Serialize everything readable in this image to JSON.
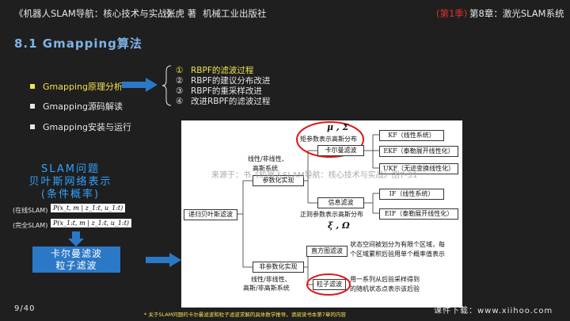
{
  "header": {
    "book_title": "《机器人SLAM导航：核心技术与实战》",
    "author": "张虎 著",
    "publisher": "机械工业出版社",
    "season": "(第1季)",
    "chapter": "第8章：激光SLAM系统"
  },
  "slide": {
    "title": "8.1 Gmapping算法",
    "bullets": [
      {
        "label": "Gmapping原理分析",
        "active": true
      },
      {
        "label": "Gmapping源码解读",
        "active": false
      },
      {
        "label": "Gmapping安装与运行",
        "active": false
      }
    ],
    "subitems": [
      {
        "num": "①",
        "label": "RBPF的滤波过程"
      },
      {
        "num": "②",
        "label": "RBPF的建议分布改进"
      },
      {
        "num": "③",
        "label": "RBPF的重采样改进"
      },
      {
        "num": "④",
        "label": "改进RBPF的滤波过程"
      }
    ],
    "bayes": {
      "line1": "SLAM问题",
      "line2": "贝叶斯网络表示",
      "line3": "(条件概率)"
    },
    "online_label": "(在线SLAM)",
    "online_eq": "P(x_t, m | z_1:t, u_1:t)",
    "full_label": "(完全SLAM)",
    "full_eq": "P(x_1:t, m | z_1:t, u_1:t)",
    "kf_line1": "卡尔曼滤波",
    "kf_line2": "粒子滤波"
  },
  "diagram": {
    "recursive_bayes": "递归贝叶斯滤波",
    "parametric": "参数化实现",
    "parametric_desc_1": "线性/非线性、",
    "parametric_desc_2": "高斯系统",
    "nonparametric": "非参数化实现",
    "nonparametric_desc_1": "线性/非线性、",
    "nonparametric_desc_2": "高斯/非高斯系统",
    "moment_symbol": "μ , Σ",
    "moment_desc": "矩参数表示高斯分布",
    "kalman": "卡尔曼滤波",
    "info_filter": "信息滤波",
    "canonical_desc": "正则参数表示高斯分布",
    "canonical_symbol": "ξ , Ω",
    "histogram": "直方图滤波",
    "histogram_desc_1": "状态空间被划分为有限个区域，每",
    "histogram_desc_2": "个区域累积后验用单个概率值表示",
    "particle": "粒子滤波",
    "particle_desc_1": "用一系列从后验采样得到",
    "particle_desc_2": "的随机状态点表示该后验",
    "kf": "KF（线性系统）",
    "ekf": "EKF（泰勒展开线性化）",
    "ukf": "UKF（无迹变换线性化）",
    "if": "IF（线性系统）",
    "eif": "EIF（泰勒展开线性化）",
    "watermark": "来源于：书《机器人SLAM导航：核心技术与实战》图7-31"
  },
  "footer": {
    "page": "9/40",
    "note": "* 关于SLAM问题的卡尔曼滤波和粒子滤波求解的具体数学推导，请阅读书本第7章的内容",
    "download": "课件下载：www.xiihoo.com"
  },
  "colors": {
    "accent_yellow": "#f3e24b",
    "title_blue": "#7fb3e6",
    "bayes_blue": "#2fa3ff",
    "box_blue": "#2b78c6",
    "season_red": "#e03030",
    "highlight_red": "#e01818"
  }
}
